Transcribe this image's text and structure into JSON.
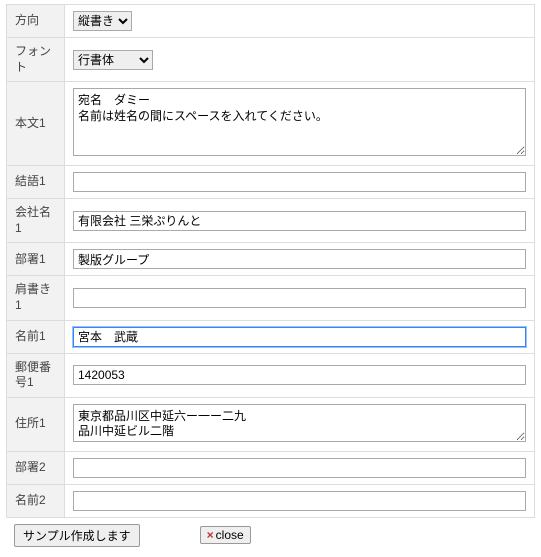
{
  "rows": {
    "direction": {
      "label": "方向",
      "value": "縦書き"
    },
    "font": {
      "label": "フォント",
      "value": "行書体"
    },
    "body1": {
      "label": "本文1",
      "value": "宛名　ダミー\n名前は姓名の間にスペースを入れてください。"
    },
    "closing1": {
      "label": "結語1",
      "value": ""
    },
    "company1": {
      "label": "会社名1",
      "value": "有限会社 三栄ぷりんと"
    },
    "dept1": {
      "label": "部署1",
      "value": "製版グループ"
    },
    "title1": {
      "label": "肩書き1",
      "value": ""
    },
    "name1": {
      "label": "名前1",
      "value": "宮本　武蔵"
    },
    "postal1": {
      "label": "郵便番号1",
      "value": "1420053"
    },
    "address1": {
      "label": "住所1",
      "value": "東京都品川区中延六ー一ー二九\n品川中延ビル二階"
    },
    "dept2": {
      "label": "部署2",
      "value": ""
    },
    "name2": {
      "label": "名前2",
      "value": ""
    }
  },
  "buttons": {
    "submit": "サンプル作成します",
    "close": "close"
  }
}
